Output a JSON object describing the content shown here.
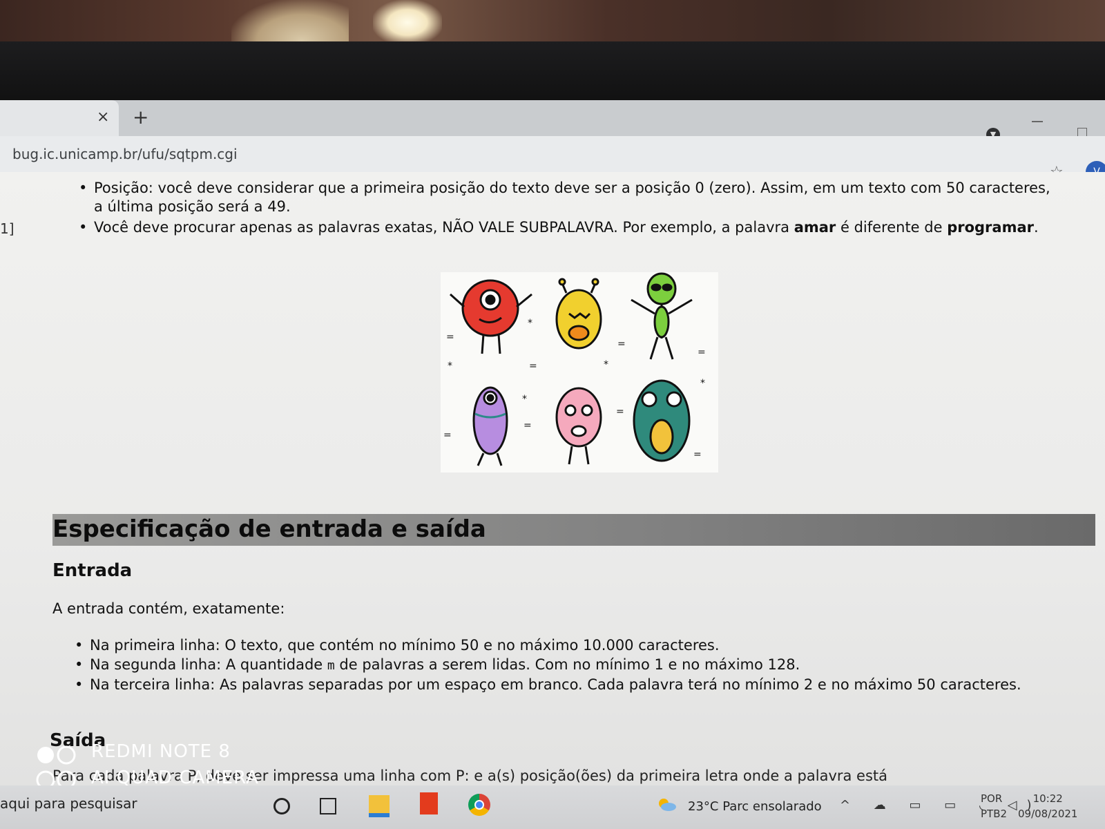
{
  "browser": {
    "tab_close": "×",
    "new_tab": "+",
    "url": "bug.ic.unicamp.br/ufu/sqtpm.cgi",
    "star_icon": "☆",
    "profile_initial": "V"
  },
  "page": {
    "left_mark": "1]",
    "top_bullets": [
      "Posição: você deve considerar que a primeira posição do texto deve ser a posição 0 (zero). Assim, em um texto com 50 caracteres, a última posição será a 49.",
      {
        "before": "Você deve procurar apenas as palavras exatas, NÃO VALE SUBPALAVRA. Por exemplo, a palavra ",
        "bold1": "amar",
        "middle": " é diferente de ",
        "bold2": "programar",
        "after": "."
      }
    ],
    "section_title": "Especificação de entrada e saída",
    "entrada_heading": "Entrada",
    "entrada_intro": "A entrada contém, exatamente:",
    "entrada_items": {
      "l1": "Na primeira linha: O texto, que contém no mínimo 50 e no máximo 10.000 caracteres.",
      "l2_before": "Na segunda linha: A quantidade ",
      "l2_code": "m",
      "l2_after": " de palavras a serem lidas. Com no mínimo 1 e no máximo 128.",
      "l3": "Na terceira linha: As palavras separadas por um espaço em branco. Cada palavra terá no mínimo 2 e no máximo 50 caracteres."
    },
    "saida_heading": "Saída",
    "saida_partial": "Para cada palavra P, deve ser impressa uma linha com P: e a(s) posição(ões) da primeira letra onde a palavra está"
  },
  "watermark": {
    "line1": "REDMI NOTE 8",
    "line2": "AI QUAD CAMERA"
  },
  "taskbar": {
    "search_placeholder": "aqui para pesquisar",
    "weather": "23°C  Parc ensolarado",
    "tray_icons": "^ ☁ ▭ ▭ ◟ ◁)",
    "lang1": "POR",
    "lang2": "PTB2",
    "time": "10:22",
    "date": "09/08/2021"
  }
}
